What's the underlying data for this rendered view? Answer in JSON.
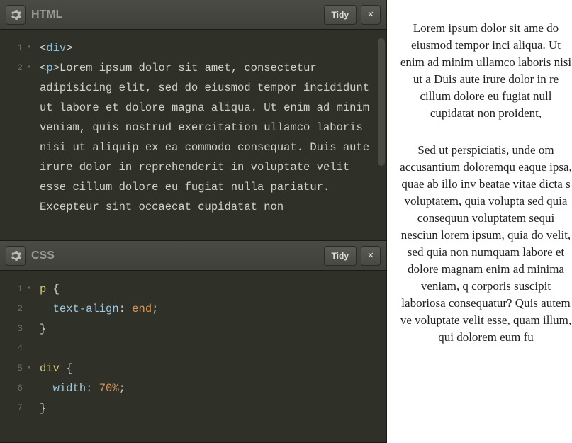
{
  "panels": {
    "html": {
      "title": "HTML",
      "tidy_label": "Tidy",
      "lines": [
        "1",
        "2"
      ],
      "code_tokens": [
        {
          "t": "punct",
          "v": "<"
        },
        {
          "t": "tag",
          "v": "div"
        },
        {
          "t": "punct",
          "v": ">"
        },
        {
          "t": "br"
        },
        {
          "t": "punct",
          "v": "<"
        },
        {
          "t": "tag",
          "v": "p"
        },
        {
          "t": "punct",
          "v": ">"
        },
        {
          "t": "text",
          "v": "Lorem ipsum dolor sit amet, consectetur adipisicing elit, sed do eiusmod tempor incididunt ut labore et dolore magna aliqua. Ut enim ad minim veniam, quis nostrud exercitation ullamco laboris nisi ut aliquip ex ea commodo consequat. Duis aute irure dolor in reprehenderit in voluptate velit esse cillum dolore eu fugiat nulla pariatur. Excepteur sint occaecat cupidatat non"
        }
      ]
    },
    "css": {
      "title": "CSS",
      "tidy_label": "Tidy",
      "lines": [
        "1",
        "2",
        "3",
        "4",
        "5",
        "6",
        "7"
      ],
      "code_tokens": [
        {
          "t": "sel",
          "v": "p"
        },
        {
          "t": "text",
          "v": " "
        },
        {
          "t": "punct",
          "v": "{"
        },
        {
          "t": "br"
        },
        {
          "t": "text",
          "v": "  "
        },
        {
          "t": "prop",
          "v": "text-align"
        },
        {
          "t": "punct",
          "v": ":"
        },
        {
          "t": "text",
          "v": " "
        },
        {
          "t": "val",
          "v": "end"
        },
        {
          "t": "punct",
          "v": ";"
        },
        {
          "t": "br"
        },
        {
          "t": "punct",
          "v": "}"
        },
        {
          "t": "br"
        },
        {
          "t": "br"
        },
        {
          "t": "sel",
          "v": "div"
        },
        {
          "t": "text",
          "v": " "
        },
        {
          "t": "punct",
          "v": "{"
        },
        {
          "t": "br"
        },
        {
          "t": "text",
          "v": "  "
        },
        {
          "t": "prop",
          "v": "width"
        },
        {
          "t": "punct",
          "v": ":"
        },
        {
          "t": "text",
          "v": " "
        },
        {
          "t": "num",
          "v": "70%"
        },
        {
          "t": "punct",
          "v": ";"
        },
        {
          "t": "br"
        },
        {
          "t": "punct",
          "v": "}"
        }
      ]
    }
  },
  "preview": {
    "p1": "Lorem ipsum dolor sit ame do eiusmod tempor inci aliqua. Ut enim ad minim ullamco laboris nisi ut a Duis aute irure dolor in re cillum dolore eu fugiat null cupidatat non proident,",
    "p2": "Sed ut perspiciatis, unde om accusantium doloremqu eaque ipsa, quae ab illo inv beatae vitae dicta s voluptatem, quia volupta sed quia consequun voluptatem sequi nesciun lorem ipsum, quia do velit, sed quia non numquam labore et dolore magnam enim ad minima veniam, q corporis suscipit laboriosa consequatur? Quis autem ve voluptate velit esse, quam illum, qui dolorem eum fu"
  }
}
